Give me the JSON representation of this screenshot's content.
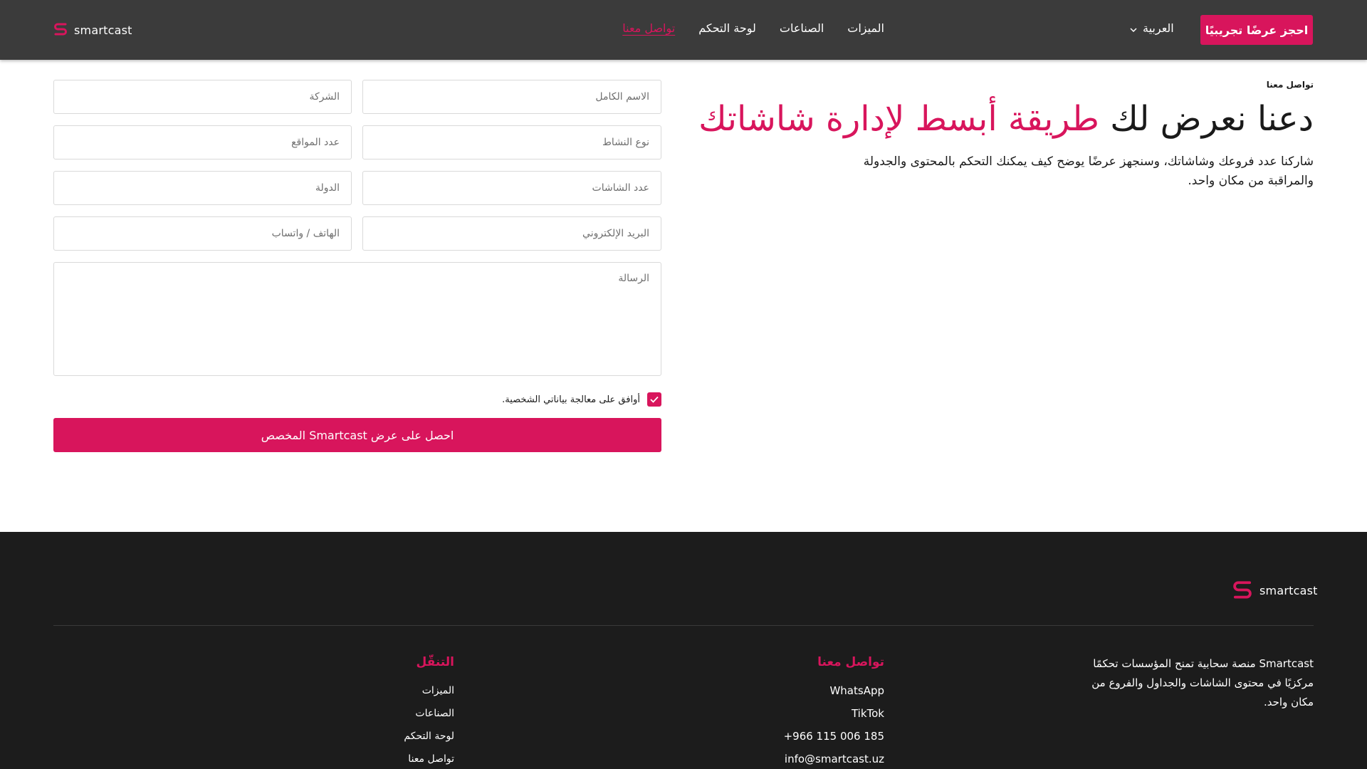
{
  "brand": {
    "name": "smartcast",
    "accent_color": "#d8155c",
    "header_bg": "#3b3b3b",
    "footer_bg": "#1c1c1c"
  },
  "header": {
    "nav": [
      "الميزات",
      "الصناعات",
      "لوحة التحكم",
      "تواصل معنا"
    ],
    "active_nav": "تواصل معنا",
    "language": "العربية",
    "cta": "احجز عرضًا تجريبيًا"
  },
  "hero": {
    "breadcrumb": "تواصل معنا",
    "title_dark": "دعنا نعرض لك ",
    "title_accent": "طريقة أبسط لإدارة شاشاتك",
    "description": "شاركنا عدد فروعك وشاشاتك، وسنجهز عرضًا يوضح كيف يمكنك التحكم بالمحتوى والجدولة والمراقبة من مكان واحد."
  },
  "form": {
    "full_name": "الاسم الكامل",
    "company": "الشركة",
    "business_type": "نوع النشاط",
    "locations": "عدد المواقع",
    "screens": "عدد الشاشات",
    "country": "الدولة",
    "email": "البريد الإلكتروني",
    "phone": "الهاتف / واتساب",
    "message": "الرسالة",
    "consent": "أوافق على معالجة بياناتي الشخصية.",
    "consent_checked": true,
    "submit": "احصل على عرض Smartcast المخصص"
  },
  "footer": {
    "about": "Smartcast منصة سحابية تمنح المؤسسات تحكمًا مركزيًا في محتوى الشاشات والجداول والفروع من مكان واحد.",
    "contact_title": "تواصل معنا",
    "contact": [
      "WhatsApp",
      "TikTok",
      "+966 115 006 185",
      "info@smartcast.uz"
    ],
    "nav_title": "التنقّل",
    "nav": [
      "الميزات",
      "الصناعات",
      "لوحة التحكم",
      "تواصل معنا"
    ]
  }
}
